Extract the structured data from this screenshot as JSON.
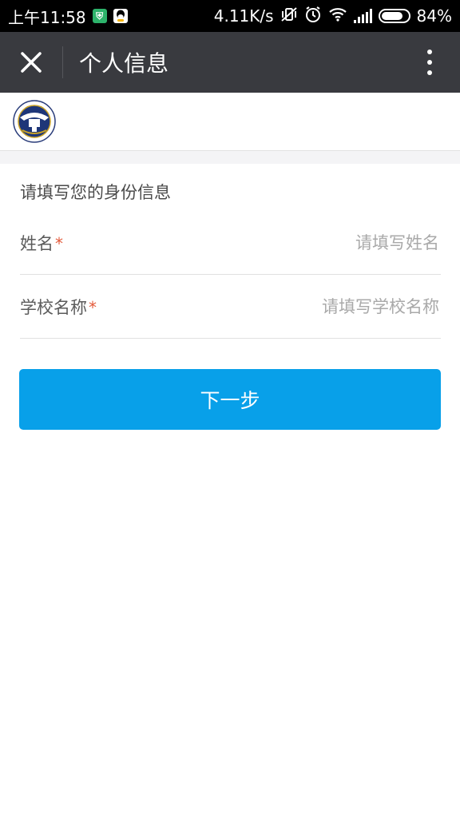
{
  "status_bar": {
    "time": "上午11:58",
    "network_speed": "4.11K/s",
    "battery": "84%",
    "battery_level": 0.84,
    "icons": [
      "shield-app-icon",
      "qq-icon",
      "vibrate-off-icon",
      "alarm-icon",
      "wifi-icon",
      "signal-icon",
      "battery-icon"
    ]
  },
  "nav": {
    "title": "个人信息",
    "close_icon": "close-icon",
    "more_icon": "more-vertical-icon"
  },
  "form": {
    "heading": "请填写您的身份信息",
    "required_mark": "*",
    "fields": [
      {
        "label": "姓名",
        "placeholder": "请填写姓名",
        "value": ""
      },
      {
        "label": "学校名称",
        "placeholder": "请填写学校名称",
        "value": ""
      }
    ],
    "submit_label": "下一步"
  },
  "colors": {
    "nav_bg": "#393a3f",
    "button_bg": "#08a0e9",
    "required": "#e35a3a"
  }
}
